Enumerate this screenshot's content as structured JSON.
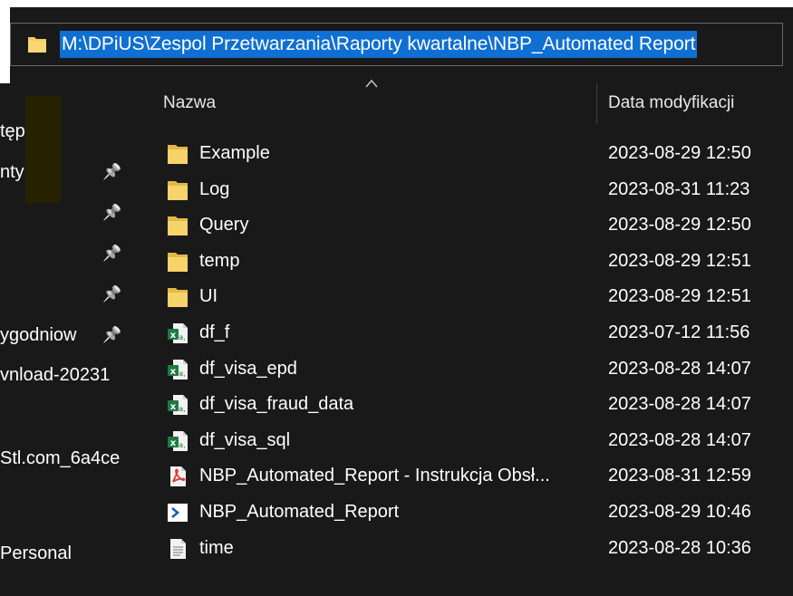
{
  "address_bar": {
    "path": "M:\\DPiUS\\Zespol Przetwarzania\\Raporty kwartalne\\NBP_Automated Report"
  },
  "nav_pane": {
    "items": [
      {
        "label": "tęp",
        "pinned": false
      },
      {
        "label": "nty",
        "pinned": true
      },
      {
        "label": "",
        "pinned": true
      },
      {
        "label": "",
        "pinned": true
      },
      {
        "label": "",
        "pinned": true
      },
      {
        "label": "ygodniow",
        "pinned": true
      },
      {
        "label": "vnload-20231",
        "pinned": false
      },
      {
        "label": "Stl.com_6a4ce",
        "pinned": false
      },
      {
        "label": "Personal",
        "pinned": false
      }
    ]
  },
  "columns": {
    "name": "Nazwa",
    "date": "Data modyfikacji"
  },
  "files": [
    {
      "name": "Example",
      "date": "2023-08-29 12:50",
      "icon": "folder-icon"
    },
    {
      "name": "Log",
      "date": "2023-08-31 11:23",
      "icon": "folder-icon"
    },
    {
      "name": "Query",
      "date": "2023-08-29 12:50",
      "icon": "folder-icon"
    },
    {
      "name": "temp",
      "date": "2023-08-29 12:51",
      "icon": "folder-icon"
    },
    {
      "name": "UI",
      "date": "2023-08-29 12:51",
      "icon": "folder-icon"
    },
    {
      "name": "df_f",
      "date": "2023-07-12 11:56",
      "icon": "excel-csv-icon"
    },
    {
      "name": "df_visa_epd",
      "date": "2023-08-28 14:07",
      "icon": "excel-csv-icon"
    },
    {
      "name": "df_visa_fraud_data",
      "date": "2023-08-28 14:07",
      "icon": "excel-csv-icon"
    },
    {
      "name": "df_visa_sql",
      "date": "2023-08-28 14:07",
      "icon": "excel-csv-icon"
    },
    {
      "name": "NBP_Automated_Report - Instrukcja Obsł...",
      "date": "2023-08-31 12:59",
      "icon": "pdf-icon"
    },
    {
      "name": "NBP_Automated_Report",
      "date": "2023-08-29 10:46",
      "icon": "powershell-icon"
    },
    {
      "name": "time",
      "date": "2023-08-28 10:36",
      "icon": "text-file-icon"
    }
  ],
  "colors": {
    "background": "#191919",
    "selection": "#0f6fd2",
    "folder": "#f4cd5b",
    "excel": "#1f7a43",
    "pdf": "#d83b2f"
  }
}
